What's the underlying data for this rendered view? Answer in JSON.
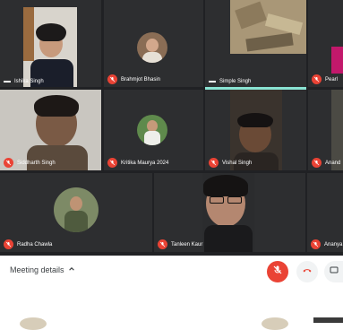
{
  "participants": [
    {
      "name": "Ishika Singh",
      "mic": "dash"
    },
    {
      "name": "Brahmjot Bhasin",
      "mic": "muted"
    },
    {
      "name": "Simple Singh",
      "mic": "dash"
    },
    {
      "name": "Pearl",
      "mic": "muted"
    },
    {
      "name": "Siddharth Singh",
      "mic": "muted"
    },
    {
      "name": "Kritika Maurya 2024",
      "mic": "muted"
    },
    {
      "name": "Vishal Singh",
      "mic": "muted"
    },
    {
      "name": "Anand",
      "mic": "muted"
    },
    {
      "name": "Radha Chawla",
      "mic": "muted"
    },
    {
      "name": "Tanleen Kaur",
      "mic": "muted"
    },
    {
      "name": "Ananya",
      "mic": "muted"
    }
  ],
  "meeting": {
    "details_label": "Meeting details"
  },
  "colors": {
    "tile_bg": "#2d2e30",
    "grid_bg": "#202124",
    "danger": "#ea4335",
    "speaking_indicator": "#8ae3d3"
  },
  "icons": [
    "mic-off-icon",
    "chevron-up-icon",
    "mic-icon",
    "phone-hangup-icon",
    "present-icon"
  ]
}
